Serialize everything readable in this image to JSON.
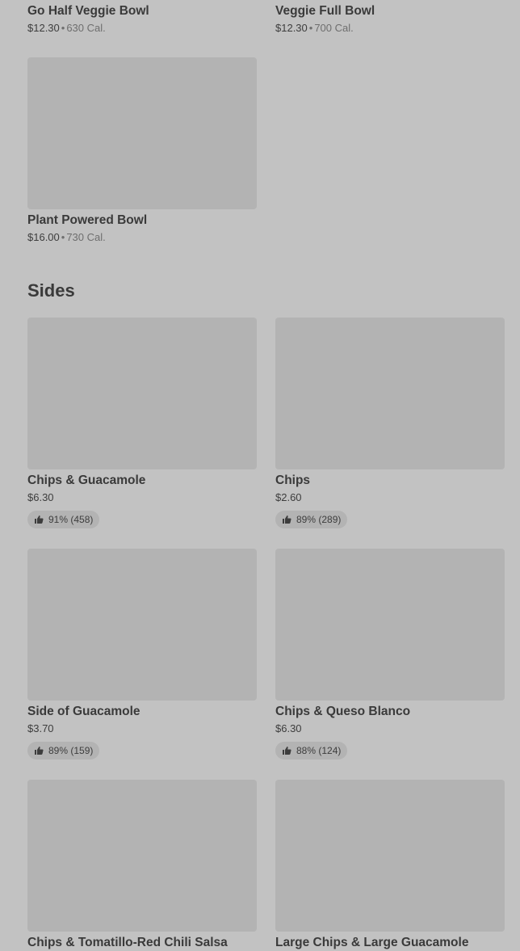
{
  "bowls": [
    {
      "name": "Go Half Veggie Bowl",
      "price": "$12.30",
      "calories": "630 Cal."
    },
    {
      "name": "Veggie Full Bowl",
      "price": "$12.30",
      "calories": "700 Cal."
    },
    {
      "name": "Plant Powered Bowl",
      "price": "$16.00",
      "calories": "730 Cal."
    }
  ],
  "sides_section": {
    "title": "Sides",
    "items": [
      {
        "name": "Chips & Guacamole",
        "price": "$6.30",
        "rating": "91% (458)"
      },
      {
        "name": "Chips",
        "price": "$2.60",
        "rating": "89% (289)"
      },
      {
        "name": "Side of Guacamole",
        "price": "$3.70",
        "rating": "89% (159)"
      },
      {
        "name": "Chips & Queso Blanco",
        "price": "$6.30",
        "rating": "88% (124)"
      },
      {
        "name": "Chips & Tomatillo-Red Chili Salsa"
      },
      {
        "name": "Large Chips & Large Guacamole"
      }
    ]
  },
  "separator": "•",
  "colors": {
    "background": "#c2c2c2",
    "placeholder": "#b3b3b3",
    "text": "#3a3a3a",
    "muted": "#6e6e6e"
  },
  "icons": {
    "rating": "thumbs-up-icon"
  }
}
